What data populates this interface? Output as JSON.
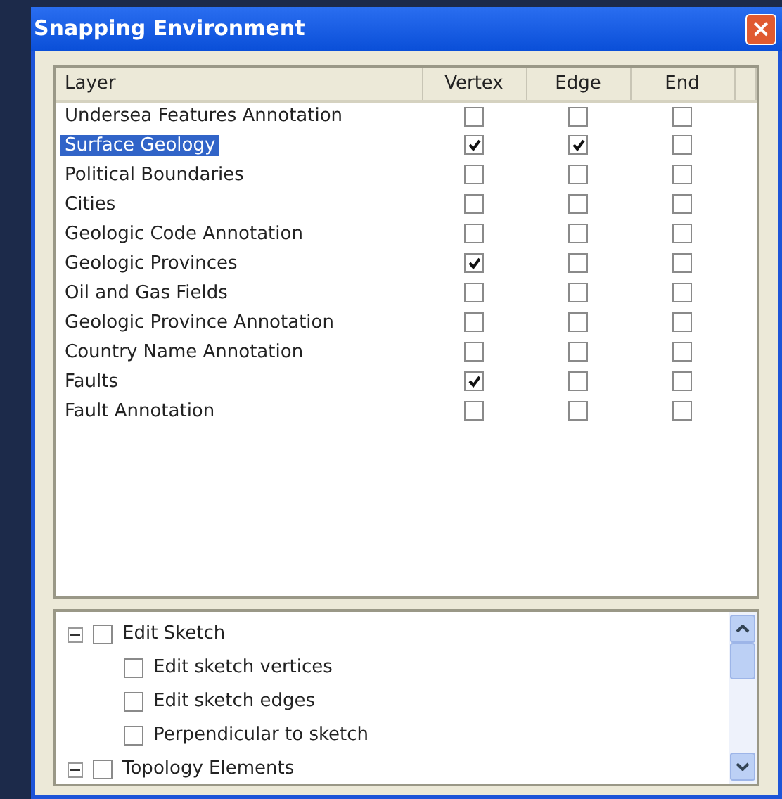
{
  "window": {
    "title": "Snapping Environment",
    "close": "×"
  },
  "table": {
    "columns": [
      "Layer",
      "Vertex",
      "Edge",
      "End"
    ],
    "rows": [
      {
        "layer": "Undersea Features Annotation",
        "selected": false,
        "vertex": false,
        "edge": false,
        "end": false
      },
      {
        "layer": "Surface Geology",
        "selected": true,
        "vertex": true,
        "edge": true,
        "end": false
      },
      {
        "layer": "Political Boundaries",
        "selected": false,
        "vertex": false,
        "edge": false,
        "end": false
      },
      {
        "layer": "Cities",
        "selected": false,
        "vertex": false,
        "edge": false,
        "end": false
      },
      {
        "layer": "Geologic Code Annotation",
        "selected": false,
        "vertex": false,
        "edge": false,
        "end": false
      },
      {
        "layer": "Geologic Provinces",
        "selected": false,
        "vertex": true,
        "edge": false,
        "end": false
      },
      {
        "layer": "Oil and Gas Fields",
        "selected": false,
        "vertex": false,
        "edge": false,
        "end": false
      },
      {
        "layer": "Geologic Province Annotation",
        "selected": false,
        "vertex": false,
        "edge": false,
        "end": false
      },
      {
        "layer": "Country Name Annotation",
        "selected": false,
        "vertex": false,
        "edge": false,
        "end": false
      },
      {
        "layer": "Faults",
        "selected": false,
        "vertex": true,
        "edge": false,
        "end": false
      },
      {
        "layer": "Fault Annotation",
        "selected": false,
        "vertex": false,
        "edge": false,
        "end": false
      }
    ]
  },
  "tree": [
    {
      "label": "Edit Sketch",
      "checked": false,
      "expanded": true,
      "children": [
        {
          "label": "Edit sketch vertices",
          "checked": false
        },
        {
          "label": "Edit sketch edges",
          "checked": false
        },
        {
          "label": "Perpendicular to sketch",
          "checked": false
        }
      ]
    },
    {
      "label": "Topology Elements",
      "checked": false,
      "expanded": true
    }
  ]
}
